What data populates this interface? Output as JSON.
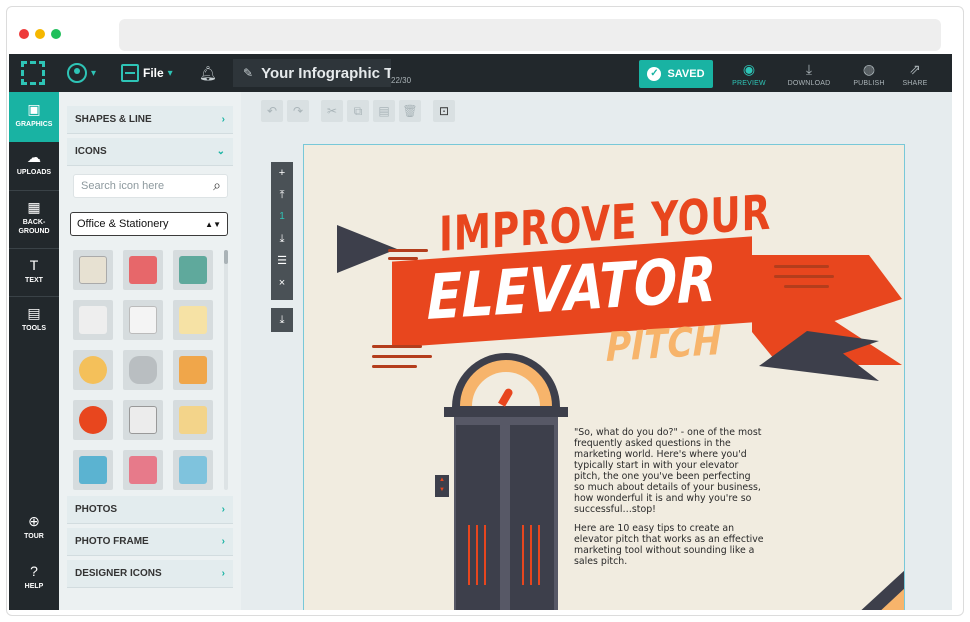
{
  "app": {
    "title": "Your Infographic Title",
    "title_count": "22/30",
    "file_label": "File",
    "saved_label": "SAVED"
  },
  "top_actions": [
    {
      "label": "PREVIEW",
      "icon": "eye-icon"
    },
    {
      "label": "DOWNLOAD",
      "icon": "download-icon"
    },
    {
      "label": "PUBLISH",
      "icon": "globe-icon"
    },
    {
      "label": "SHARE",
      "icon": "share-icon"
    }
  ],
  "left_nav": [
    {
      "label": "GRAPHICS",
      "icon": "image-icon",
      "active": true
    },
    {
      "label": "UPLOADS",
      "icon": "cloud-upload-icon"
    },
    {
      "label": "BACK-\nGROUND",
      "icon": "background-icon"
    },
    {
      "label": "TEXT",
      "icon": "text-icon"
    },
    {
      "label": "TOOLS",
      "icon": "toolbox-icon"
    }
  ],
  "left_nav_bottom": [
    {
      "label": "TOUR",
      "icon": "signpost-icon"
    },
    {
      "label": "HELP",
      "icon": "question-icon"
    }
  ],
  "panel": {
    "sections_top": [
      {
        "label": "SHAPES & LINE",
        "arrow": "›"
      },
      {
        "label": "ICONS",
        "arrow": "⌄"
      }
    ],
    "search_placeholder": "Search icon here",
    "category": "Office & Stationery",
    "sections_bottom": [
      {
        "label": "PHOTOS",
        "arrow": "›"
      },
      {
        "label": "PHOTO FRAME",
        "arrow": "›"
      },
      {
        "label": "DESIGNER ICONS",
        "arrow": "›"
      }
    ]
  },
  "canvas": {
    "zoom_level": "1",
    "headline_line1": "IMPROVE YOUR",
    "headline_line2": "ELEVATOR",
    "headline_line3": "PITCH",
    "paragraph1": "\"So, what do you do?\" - one of the most frequently asked questions in the marketing world. Here's where you'd typically start in with your elevator pitch, the one you've been perfecting so much about details of your business, how wonderful it is and why you're so successful…stop!",
    "paragraph2": "Here are 10 easy tips to create an elevator pitch that works as an effective marketing tool without sounding like a sales pitch."
  },
  "colors": {
    "accent": "#19b3a3",
    "dark": "#22282c",
    "ribbon": "#e8461e",
    "ribbon_dark": "#3d3f4b",
    "peach": "#f7b46b"
  }
}
